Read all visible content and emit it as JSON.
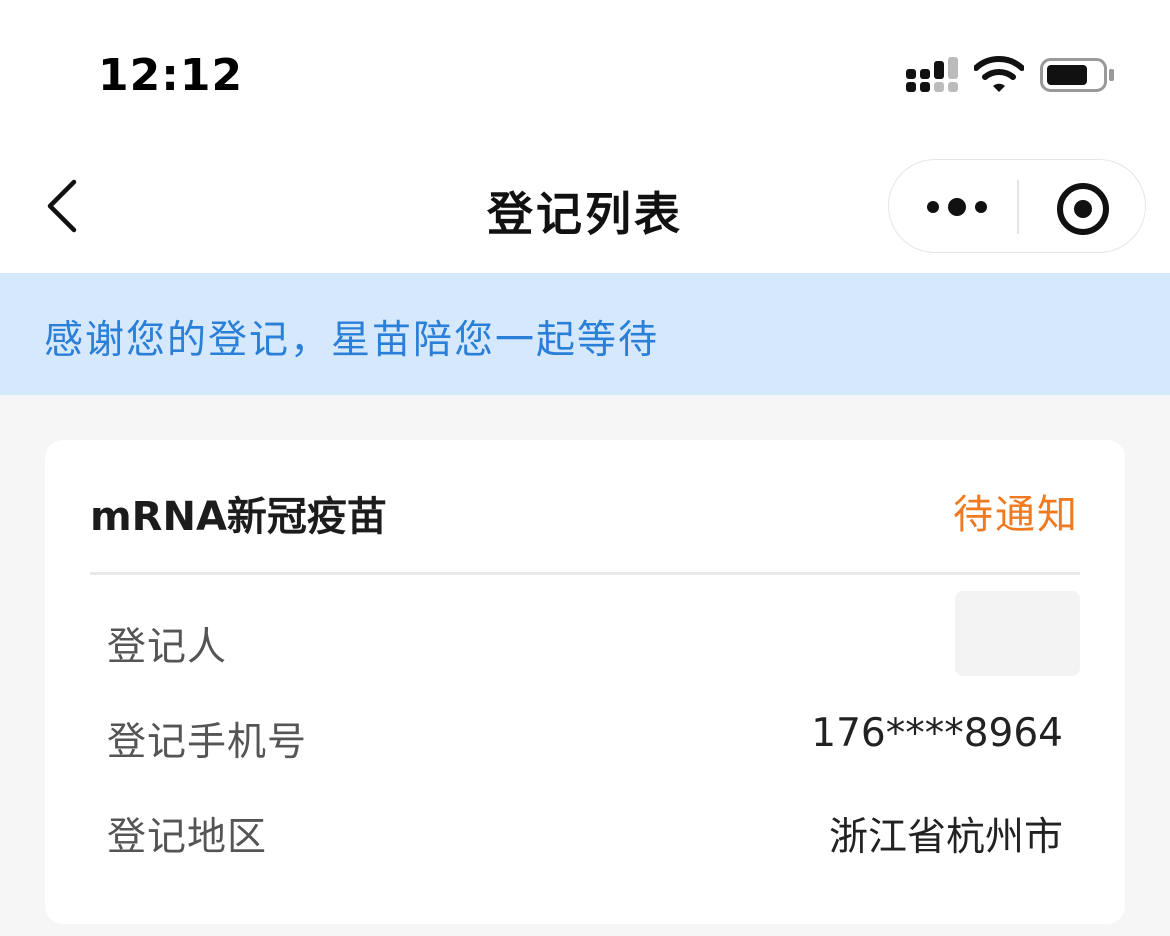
{
  "status_bar": {
    "time": "12:12"
  },
  "nav": {
    "title": "登记列表"
  },
  "banner": {
    "text": "感谢您的登记，星苗陪您一起等待"
  },
  "card": {
    "title": "mRNA新冠疫苗",
    "status": "待通知",
    "status_color": "#f07a20",
    "rows": [
      {
        "label": "登记人",
        "value": ""
      },
      {
        "label": "登记手机号",
        "value": "176****8964"
      },
      {
        "label": "登记地区",
        "value": "浙江省杭州市"
      }
    ]
  },
  "colors": {
    "banner_bg": "#d6e8fb",
    "banner_text": "#2a7fd9",
    "page_bg": "#f6f6f6"
  }
}
